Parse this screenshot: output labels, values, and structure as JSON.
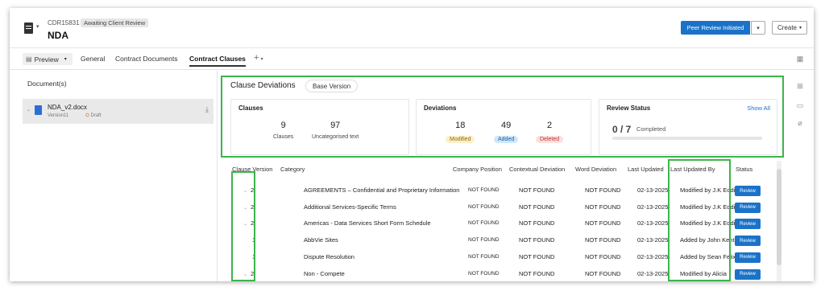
{
  "header": {
    "contract_id": "CDR15831",
    "status": "Awaiting Client Review",
    "title": "NDA",
    "primary_action": "Peer Review Initiated",
    "create_label": "Create"
  },
  "tabs": [
    {
      "label": "Preview"
    },
    {
      "label": "General"
    },
    {
      "label": "Contract Documents"
    },
    {
      "label": "Contract Clauses"
    }
  ],
  "add_tab_label": "+",
  "documents": {
    "heading": "Document(s)",
    "file_name": "NDA_v2.docx",
    "version": "Version11",
    "state": "Draft"
  },
  "deviations": {
    "title": "Clause Deviations",
    "base_version": "Base Version",
    "clauses": {
      "title": "Clauses",
      "clauses_count": "9",
      "clauses_label": "Clauses",
      "uncategorised_count": "97",
      "uncategorised_label": "Uncategorised text"
    },
    "deviation_card": {
      "title": "Deviations",
      "modified_count": "18",
      "modified_label": "Modified",
      "added_count": "49",
      "added_label": "Added",
      "deleted_count": "2",
      "deleted_label": "Deleted"
    },
    "review_status": {
      "title": "Review Status",
      "show_all": "Show All",
      "count": "0 / 7",
      "label": "Completed",
      "progress": 0
    }
  },
  "table": {
    "headers": [
      "Clause Version",
      "Category",
      "Company Position",
      "Contextual Deviation",
      "Word Deviation",
      "Last Updated",
      "Last Updated By",
      "Status"
    ],
    "rows": [
      {
        "version": "2",
        "expandable": true,
        "category": "AGREEMENTS – Confidential and Proprietary Information",
        "company_position": "NOT FOUND",
        "contextual": "NOT FOUND",
        "word": "NOT FOUND",
        "updated": "02-13-2025",
        "updated_by": "Modified by J.K Eddie",
        "status": "Review"
      },
      {
        "version": "2",
        "expandable": true,
        "category": "Additional Services-Specific Terms",
        "company_position": "NOT FOUND",
        "contextual": "NOT FOUND",
        "word": "NOT FOUND",
        "updated": "02-13-2025",
        "updated_by": "Modified by J.K Eddie",
        "status": "Review"
      },
      {
        "version": "2",
        "expandable": true,
        "category": "Americas - Data Services Short Form Schedule",
        "company_position": "NOT FOUND",
        "contextual": "NOT FOUND",
        "word": "NOT FOUND",
        "updated": "02-13-2025",
        "updated_by": "Modified by J.K Eddie",
        "status": "Review"
      },
      {
        "version": "1",
        "expandable": false,
        "category": "AbbVie Sites",
        "company_position": "NOT FOUND",
        "contextual": "NOT FOUND",
        "word": "NOT FOUND",
        "updated": "02-13-2025",
        "updated_by": "Added by John Kent",
        "status": "Review"
      },
      {
        "version": "1",
        "expandable": false,
        "category": "Dispute Resolution",
        "company_position": "NOT FOUND",
        "contextual": "NOT FOUND",
        "word": "NOT FOUND",
        "updated": "02-13-2025",
        "updated_by": "Added by Sean Felix",
        "status": "Review"
      },
      {
        "version": "2",
        "expandable": true,
        "category": "Non - Compete",
        "company_position": "NOT FOUND",
        "contextual": "NOT FOUND",
        "word": "NOT FOUND",
        "updated": "02-13-2025",
        "updated_by": "Modified by Alicia",
        "status": "Review"
      }
    ]
  },
  "colors": {
    "accent": "#1a73c8",
    "highlight": "#3cb44b",
    "modified_pill": "#fdf0c8",
    "added_pill": "#cfe6fb",
    "deleted_pill": "#fbe0de"
  }
}
